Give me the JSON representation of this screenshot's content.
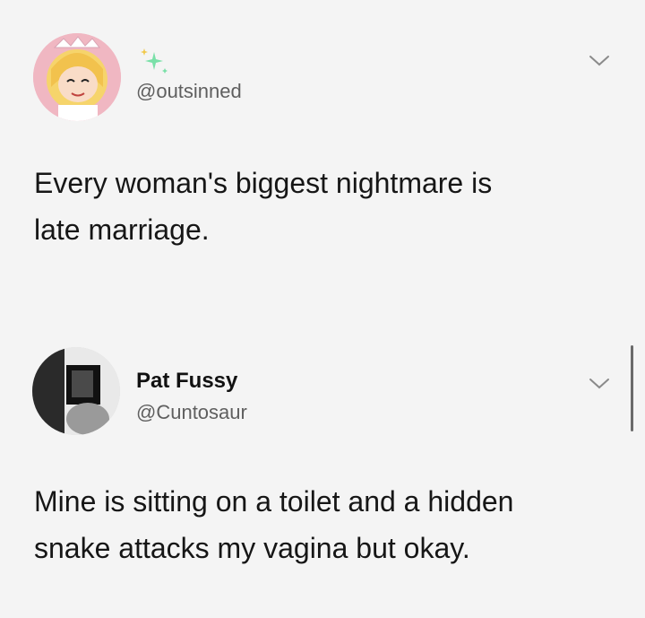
{
  "tweets": [
    {
      "username": "",
      "handle": "@outsinned",
      "text": "Every woman's biggest nightmare is\nlate marriage.",
      "avatar_icon": "cartoon-princess-avatar",
      "name_icon": "sparkles-icon"
    },
    {
      "username": "Pat Fussy",
      "handle": "@Cuntosaur",
      "text": "Mine is sitting on a toilet and a hidden\nsnake attacks my vagina but okay.",
      "avatar_icon": "photo-avatar"
    }
  ],
  "colors": {
    "background": "#f4f4f4",
    "text": "#161616",
    "handle": "#5f5f5f",
    "sparkle": "#79e0a8"
  }
}
